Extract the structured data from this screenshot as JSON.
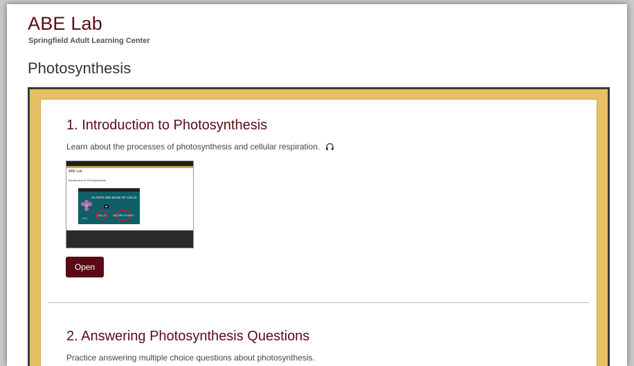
{
  "site": {
    "title": "ABE Lab",
    "subtitle": "Springfield Adult Learning Center"
  },
  "page": {
    "heading": "Photosynthesis"
  },
  "lessons": [
    {
      "title": "1. Introduction to Photosynthesis",
      "description": "Learn about the processes of photosynthesis and cellular respiration.",
      "audio_icon": "headphones-icon",
      "open_label": "Open",
      "thumbnail": {
        "site_title": "ABE Lab",
        "lesson_title": "Introduction to Photosynthesis",
        "video_text_1": "PLANTS ARE MADE OF CELLS",
        "video_text_2": "CELLS",
        "video_text_3": "CHLORO-PLASTS"
      }
    },
    {
      "title": "2. Answering Photosynthesis Questions",
      "description": "Practice answering multiple choice questions about photosynthesis."
    }
  ],
  "colors": {
    "brand": "#5b0a15",
    "frame_gold": "#e6c063",
    "frame_dark": "#3a3a3a"
  }
}
